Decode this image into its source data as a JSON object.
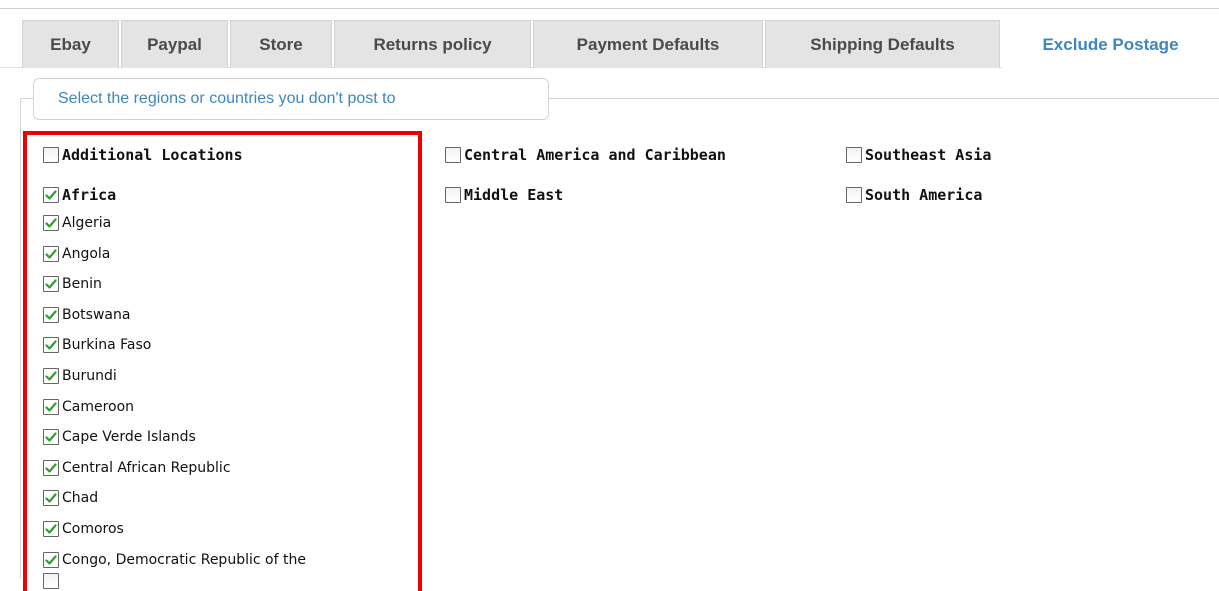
{
  "tabs": [
    {
      "label": "Ebay",
      "active": false
    },
    {
      "label": "Paypal",
      "active": false
    },
    {
      "label": "Store",
      "active": false
    },
    {
      "label": "Returns policy",
      "active": false
    },
    {
      "label": "Payment Defaults",
      "active": false
    },
    {
      "label": "Shipping Defaults",
      "active": false
    },
    {
      "label": "Exclude Postage",
      "active": true
    }
  ],
  "section": {
    "legend": "Select the regions or countries you don't post to"
  },
  "colors": {
    "accent": "#3d87bd",
    "highlight_border": "#ee0000",
    "checkmark": "#2e9e2e"
  },
  "regions": [
    {
      "label": "Additional Locations",
      "checked": false
    },
    {
      "label": "Africa",
      "checked": true
    },
    {
      "label": "Central America and Caribbean",
      "checked": false
    },
    {
      "label": "Middle East",
      "checked": false
    },
    {
      "label": "Southeast Asia",
      "checked": false
    },
    {
      "label": "South America",
      "checked": false
    }
  ],
  "countries": [
    {
      "label": "Algeria",
      "checked": true
    },
    {
      "label": "Angola",
      "checked": true
    },
    {
      "label": "Benin",
      "checked": true
    },
    {
      "label": "Botswana",
      "checked": true
    },
    {
      "label": "Burkina Faso",
      "checked": true
    },
    {
      "label": "Burundi",
      "checked": true
    },
    {
      "label": "Cameroon",
      "checked": true
    },
    {
      "label": "Cape Verde Islands",
      "checked": true
    },
    {
      "label": "Central African Republic",
      "checked": true
    },
    {
      "label": "Chad",
      "checked": true
    },
    {
      "label": "Comoros",
      "checked": true
    },
    {
      "label": "Congo, Democratic Republic of the",
      "checked": true
    }
  ]
}
